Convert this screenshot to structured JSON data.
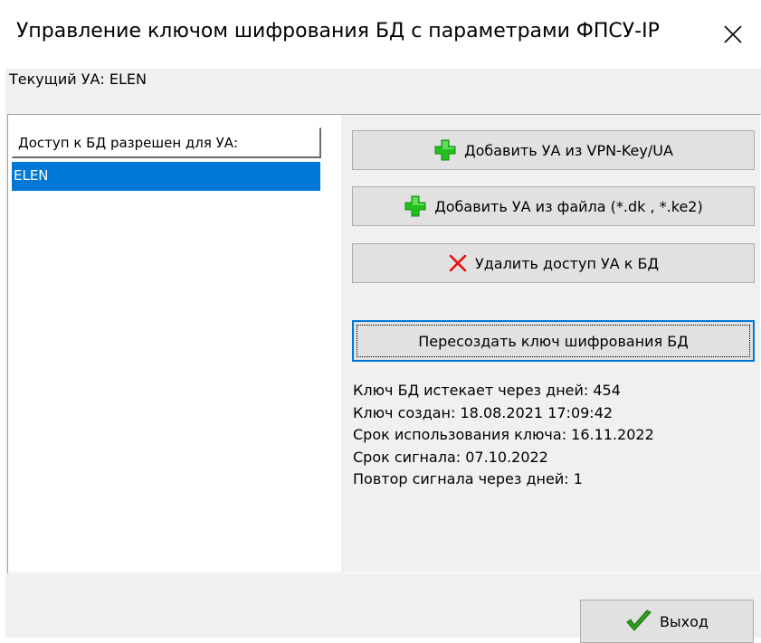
{
  "window": {
    "title": "Управление ключом шифрования БД с параметрами ФПСУ-IP",
    "close_icon": "close-icon"
  },
  "current_ua": {
    "text": "Текущий УА: ELEN"
  },
  "access_list": {
    "header": "Доступ к БД разрешен для УА:",
    "items": [
      {
        "label": "ELEN",
        "selected": true
      }
    ]
  },
  "buttons": {
    "add_vpn": {
      "label": "Добавить УА из VPN-Key/UA",
      "icon": "plus-icon",
      "icon_color": "#22c01e"
    },
    "add_file": {
      "label": "Добавить УА из файла (*.dk , *.ke2)",
      "icon": "plus-icon",
      "icon_color": "#22c01e"
    },
    "remove": {
      "label": "Удалить доступ УА  к БД",
      "icon": "cross-icon",
      "icon_color": "#e81010"
    },
    "recreate": {
      "label": "Пересоздать ключ шифрования БД"
    },
    "exit": {
      "label": "Выход",
      "icon": "checkmark-icon",
      "icon_color": "#2f9e1e"
    }
  },
  "key_info": {
    "expires": "Ключ БД истекает через дней: 454",
    "created": "Ключ создан: 18.08.2021 17:09:42",
    "usage_term": "Срок использования ключа: 16.11.2022",
    "signal_term": "Срок сигнала: 07.10.2022",
    "signal_repeat": "Повтор сигнала через дней: 1"
  },
  "colors": {
    "selection": "#0078d7",
    "dialog_bg": "#f0f0f0",
    "button_bg": "#e1e1e1"
  }
}
